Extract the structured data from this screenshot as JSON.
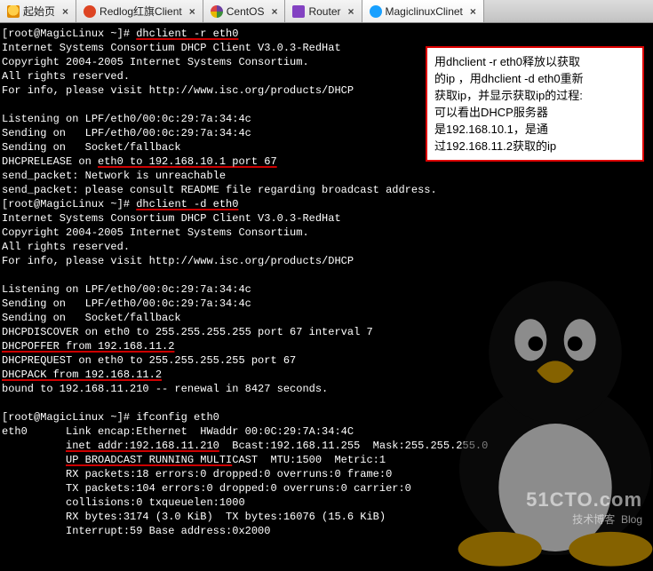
{
  "tabs": [
    {
      "label": "起始页",
      "icon": "home-icon"
    },
    {
      "label": "Redlog红旗Client",
      "icon": "redflag-icon"
    },
    {
      "label": "CentOS",
      "icon": "centos-icon"
    },
    {
      "label": "Router",
      "icon": "router-icon"
    },
    {
      "label": "MagiclinuxClinet",
      "icon": "magic-icon",
      "active": true
    }
  ],
  "note_lines": [
    "用dhclient -r eth0释放以获取",
    "的ip ，用dhclient -d eth0重新",
    "获取ip，并显示获取ip的过程:",
    "可以看出DHCP服务器",
    "是192.168.10.1，是通",
    "过192.168.11.2获取的ip"
  ],
  "watermark": {
    "big": "51CTO.com",
    "small": "技术博客",
    "tag": "Blog"
  },
  "term": {
    "p1a": "[root@MagicLinux ~]# ",
    "p1b": "dhclient -r eth0",
    "l2": "Internet Systems Consortium DHCP Client V3.0.3-RedHat",
    "l3": "Copyright 2004-2005 Internet Systems Consortium.",
    "l4": "All rights reserved.",
    "l5": "For info, please visit http://www.isc.org/products/DHCP",
    "l6": "",
    "l7": "Listening on LPF/eth0/00:0c:29:7a:34:4c",
    "l8": "Sending on   LPF/eth0/00:0c:29:7a:34:4c",
    "l9": "Sending on   Socket/fallback",
    "l10a": "DHCPRELEASE on ",
    "l10b": "eth0 to 192.168.10.1 port 67",
    "l11": "send_packet: Network is unreachable",
    "l12": "send_packet: please consult README file regarding broadcast address.",
    "p2a": "[root@MagicLinux ~]# ",
    "p2b": "dhclient -d eth0",
    "l14": "Internet Systems Consortium DHCP Client V3.0.3-RedHat",
    "l15": "Copyright 2004-2005 Internet Systems Consortium.",
    "l16": "All rights reserved.",
    "l17": "For info, please visit http://www.isc.org/products/DHCP",
    "l18": "",
    "l19": "Listening on LPF/eth0/00:0c:29:7a:34:4c",
    "l20": "Sending on   LPF/eth0/00:0c:29:7a:34:4c",
    "l21": "Sending on   Socket/fallback",
    "l22": "DHCPDISCOVER on eth0 to 255.255.255.255 port 67 interval 7",
    "l23": "DHCPOFFER from 192.168.11.2",
    "l24": "DHCPREQUEST on eth0 to 255.255.255.255 port 67",
    "l25": "DHCPACK from 192.168.11.2",
    "l26": "bound to 192.168.11.210 -- renewal in 8427 seconds.",
    "l27": "",
    "p3": "[root@MagicLinux ~]# ifconfig eth0",
    "l29": "eth0      Link encap:Ethernet  HWaddr 00:0C:29:7A:34:4C",
    "l30a": "          ",
    "l30b": "inet addr:192.168.11.210",
    "l30c": "  Bcast:192.168.11.255  Mask:255.255.255.0",
    "l31a": "          ",
    "l31b": "UP BROADCAST RUNNING MULTI",
    "l31c": "CAST  MTU:1500  Metric:1",
    "l32": "          RX packets:18 errors:0 dropped:0 overruns:0 frame:0",
    "l33": "          TX packets:104 errors:0 dropped:0 overruns:0 carrier:0",
    "l34": "          collisions:0 txqueuelen:1000",
    "l35": "          RX bytes:3174 (3.0 KiB)  TX bytes:16076 (15.6 KiB)",
    "l36": "          Interrupt:59 Base address:0x2000"
  }
}
